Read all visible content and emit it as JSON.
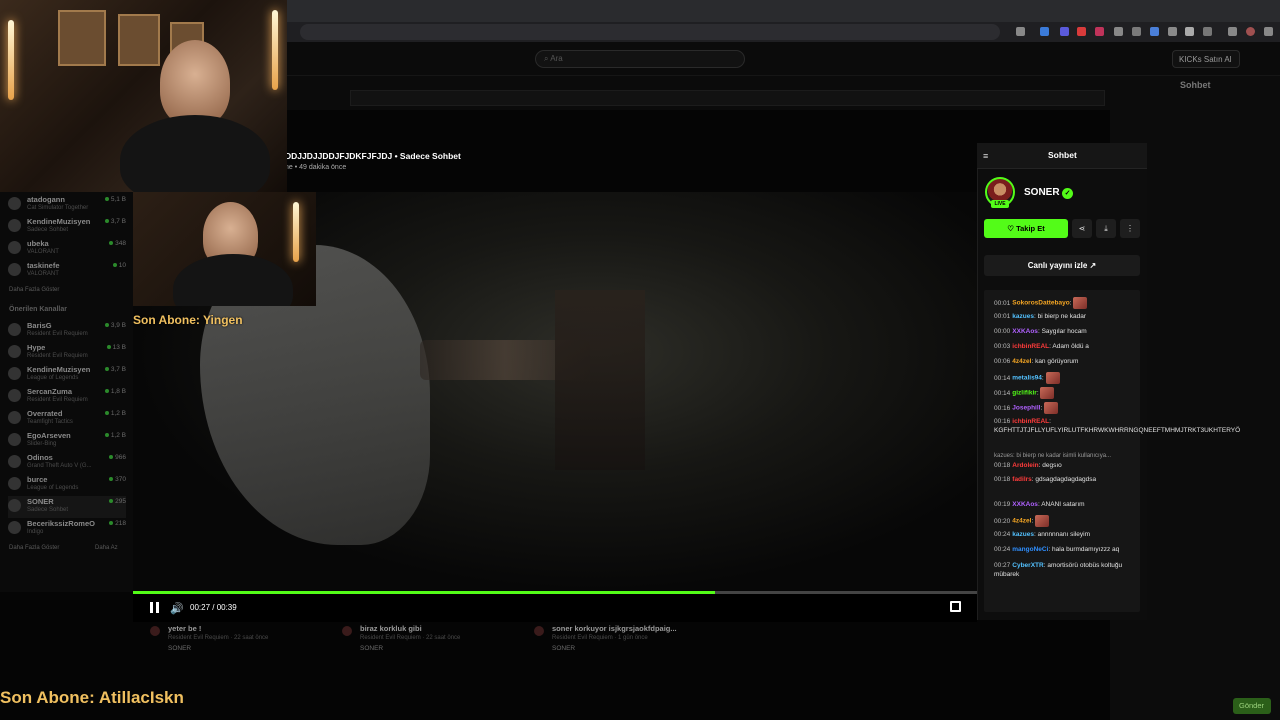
{
  "overlay": {
    "sub_top": "Son Abone: Yingen",
    "sub_bottom": "Son Abone: AtillacIskn"
  },
  "kick": {
    "search_placeholder": "Ara",
    "buy_label": "KICKs Satın Al"
  },
  "video": {
    "title": "DDJJDJJDDJFJDKFJFJDJ • Sadece Sohbet",
    "meta": "ne • 49 dakika önce",
    "time": "00:27 / 00:39",
    "progress": 0.69
  },
  "sidebar": {
    "channels": [
      {
        "name": "atadogann",
        "game": "Cat Simulator Together",
        "count": "5,1 B"
      },
      {
        "name": "KendineMuzisyen",
        "game": "Sadece Sohbet",
        "count": "3,7 B"
      },
      {
        "name": "ubeka",
        "game": "VALORANT",
        "count": "348"
      },
      {
        "name": "taskinefe",
        "game": "VALORANT",
        "count": "10"
      }
    ],
    "more1": "Daha Fazla Göster",
    "recommended_title": "Önerilen Kanallar",
    "recommended": [
      {
        "name": "BarisG",
        "game": "Resident Evil Requiem",
        "count": "3,9 B"
      },
      {
        "name": "Hype",
        "game": "Resident Evil Requiem",
        "count": "13 B"
      },
      {
        "name": "KendineMuzisyen",
        "game": "League of Legends",
        "count": "3,7 B"
      },
      {
        "name": "SercanZuma",
        "game": "Resident Evil Requiem",
        "count": "1,8 B"
      },
      {
        "name": "Overrated",
        "game": "Teamfight Tactics",
        "count": "1,2 B"
      },
      {
        "name": "EgoArseven",
        "game": "Slider-Bing",
        "count": "1,2 B"
      },
      {
        "name": "Odinos",
        "game": "Grand Theft Auto V (G...",
        "count": "966"
      },
      {
        "name": "burce",
        "game": "League of Legends",
        "count": "370"
      },
      {
        "name": "SONER",
        "game": "Sadece Sohbet",
        "count": "295"
      },
      {
        "name": "BecerikssizRomeO",
        "game": "Indigo",
        "count": "218"
      }
    ],
    "more2": "Daha Fazla Göster",
    "less": "Daha Az"
  },
  "recs": [
    {
      "title": "yeter be !",
      "sub": "Resident Evil Requiem · 22 saat önce",
      "channel": "SONER"
    },
    {
      "title": "biraz korkluk gibi",
      "sub": "Resident Evil Requiem · 22 saat önce",
      "channel": "SONER"
    },
    {
      "title": "soner korkuyor isjkgrsjaokfdpaig...",
      "sub": "Resident Evil Requiem · 1 gün önce",
      "channel": "SONER"
    }
  ],
  "panel": {
    "title": "Sohbet",
    "streamer": "SONER",
    "live": "LIVE",
    "follow": "Takip Et",
    "watch": "Canlı yayını izle"
  },
  "messages": [
    {
      "t": "00:01",
      "u": "SokorosDattebayo",
      "c": "#f5a623",
      "txt": "",
      "emote": true
    },
    {
      "t": "00:01",
      "u": "kazues",
      "c": "#53c1ff",
      "txt": "bi bierp ne kadar",
      "emote": false
    },
    {
      "t": "00:00",
      "u": "XXKAos",
      "c": "#b061ff",
      "txt": "Saygılar hocam",
      "emote": false
    },
    {
      "t": "00:03",
      "u": "ichbinREAL",
      "c": "#ff3b3b",
      "txt": "Adam öldü a",
      "emote": false
    },
    {
      "t": "00:06",
      "u": "4z4zel",
      "c": "#f5a623",
      "txt": "kan görüyorum",
      "emote": false
    },
    {
      "t": "00:14",
      "u": "metalis94",
      "c": "#53c1ff",
      "txt": "",
      "emote": true
    },
    {
      "t": "00:14",
      "u": "gizlifikir",
      "c": "#53fc18",
      "txt": "",
      "emote": true
    },
    {
      "t": "00:16",
      "u": "Josephill",
      "c": "#b061ff",
      "txt": "",
      "emote": true
    },
    {
      "t": "00:16",
      "u": "ichbinREAL",
      "c": "#ff3b3b",
      "txt": "KGFHTTJTJFLLYUFLYIRLUTFKHRWKWHRRNGQNEEFTMHMJTRKT3UKHTERYÖ",
      "emote": false
    },
    {
      "t": "",
      "u": "",
      "c": "#999",
      "txt": "kazues: bi bierp ne kadar isimli kullanıcıya...",
      "emote": false,
      "reply": true
    },
    {
      "t": "00:18",
      "u": "Ardolein",
      "c": "#ff3b3b",
      "txt": "degsıo",
      "emote": false
    },
    {
      "t": "00:18",
      "u": "fadilrs",
      "c": "#ff3b3b",
      "txt": "gdsagdagdagdagdsa",
      "emote": false
    },
    {
      "t": "00:19",
      "u": "XXKAos",
      "c": "#b061ff",
      "txt": "ANANI satarım",
      "emote": false
    },
    {
      "t": "00:20",
      "u": "4z4zel",
      "c": "#f5a623",
      "txt": "",
      "emote": true
    },
    {
      "t": "00:24",
      "u": "kazues",
      "c": "#53c1ff",
      "txt": "annnnnanı sileyim",
      "emote": false
    },
    {
      "t": "00:24",
      "u": "mangoNeCi",
      "c": "#2f8fff",
      "txt": "hala burmdamıyızzz aq",
      "emote": false
    },
    {
      "t": "00:27",
      "u": "CyberXTR",
      "c": "#53c1ff",
      "txt": "amortisörü otobüs koltuğu mübarek",
      "emote": false
    }
  ],
  "bg_chat": {
    "title": "Sohbet",
    "send": "Gönder"
  }
}
